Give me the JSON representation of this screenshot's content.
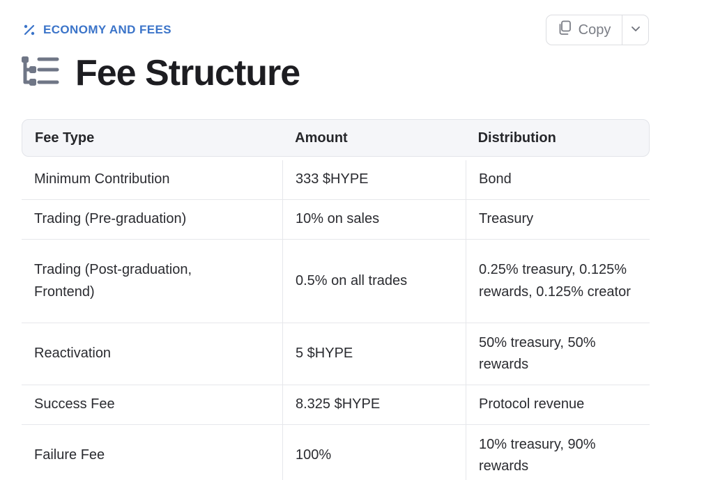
{
  "eyebrow": {
    "label": "ECONOMY AND FEES",
    "icon": "percent-icon",
    "color": "#3b74c9"
  },
  "page": {
    "title": "Fee Structure",
    "title_icon": "list-tree-icon"
  },
  "copy": {
    "label": "Copy",
    "icon": "copy-icon",
    "caret_icon": "chevron-down-icon"
  },
  "table": {
    "headers": [
      "Fee Type",
      "Amount",
      "Distribution"
    ],
    "rows": [
      {
        "fee_type": "Minimum Contribution",
        "amount": "333 $HYPE",
        "distribution": "Bond"
      },
      {
        "fee_type": "Trading (Pre-graduation)",
        "amount": "10% on sales",
        "distribution": "Treasury"
      },
      {
        "fee_type": "Trading (Post-graduation, Frontend)",
        "amount": "0.5% on all trades",
        "distribution": "0.25% treasury, 0.125% rewards, 0.125% creator"
      },
      {
        "fee_type": "Reactivation",
        "amount": "5 $HYPE",
        "distribution": "50% treasury, 50% rewards"
      },
      {
        "fee_type": "Success Fee",
        "amount": "8.325 $HYPE",
        "distribution": "Protocol revenue"
      },
      {
        "fee_type": "Failure Fee",
        "amount": "100%",
        "distribution": "10% treasury, 90% rewards"
      }
    ]
  }
}
